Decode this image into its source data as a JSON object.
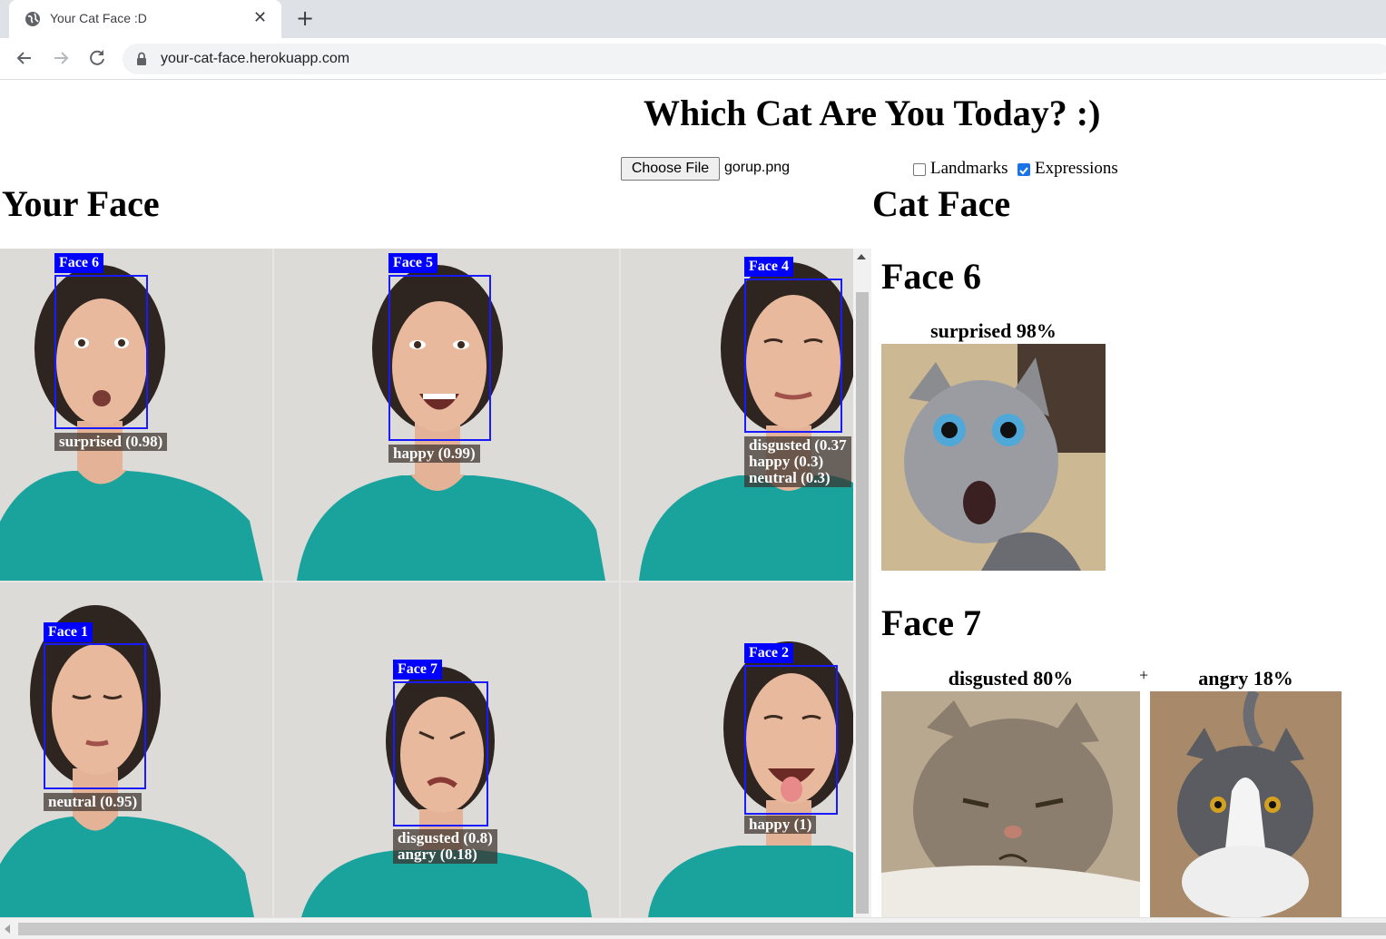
{
  "browser": {
    "tab_title": "Your Cat Face :D",
    "url": "your-cat-face.herokuapp.com"
  },
  "page": {
    "title": "Which Cat Are You Today? :)",
    "file_button": "Choose File",
    "file_name": "gorup.png",
    "landmarks_label": "Landmarks",
    "landmarks_checked": false,
    "expressions_label": "Expressions",
    "expressions_checked": true,
    "your_face_heading": "Your Face",
    "cat_face_heading": "Cat Face"
  },
  "faces": {
    "f6": {
      "label": "Face 6",
      "lines": [
        "surprised (0.98)"
      ]
    },
    "f5": {
      "label": "Face 5",
      "lines": [
        "happy (0.99)"
      ]
    },
    "f4": {
      "label": "Face 4",
      "lines": [
        "disgusted (0.37",
        "happy (0.3)",
        "neutral (0.3)"
      ]
    },
    "f1": {
      "label": "Face 1",
      "lines": [
        "neutral (0.95)"
      ]
    },
    "f7": {
      "label": "Face 7",
      "lines": [
        "disgusted (0.8)",
        "angry (0.18)"
      ]
    },
    "f2": {
      "label": "Face 2",
      "lines": [
        "happy (1)"
      ]
    }
  },
  "results": {
    "r1": {
      "heading": "Face 6",
      "cat1_caption": "surprised 98%"
    },
    "r2": {
      "heading": "Face 7",
      "cat1_caption": "disgusted 80%",
      "plus": "+",
      "cat2_caption": "angry 18%"
    }
  },
  "colors": {
    "face_box": "#1a1aff",
    "shirt": "#1aa39d",
    "skin": "#e8b99d",
    "hair": "#2e2420",
    "checkbox_accent": "#1a73e8"
  }
}
